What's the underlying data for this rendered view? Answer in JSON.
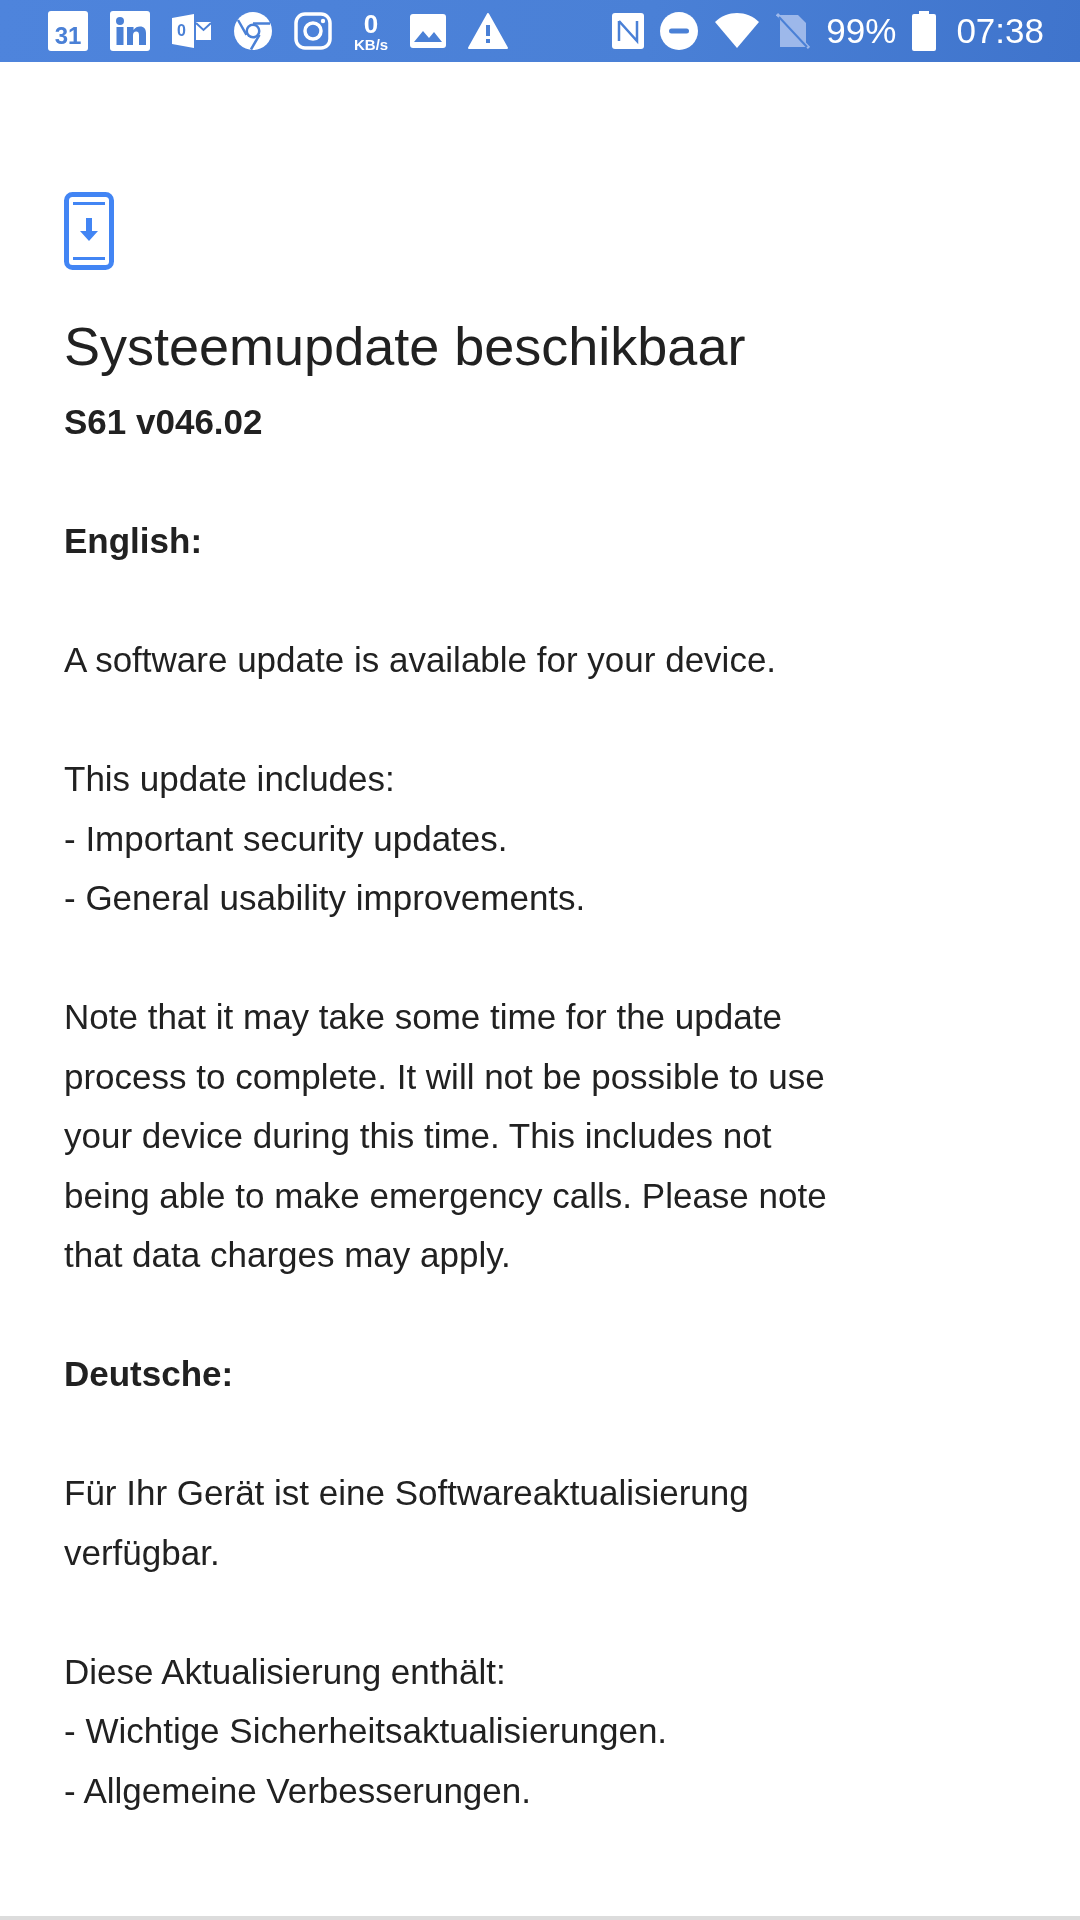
{
  "status_bar": {
    "calendar_date": "31",
    "outlook_badge": "0",
    "net_speed_value": "0",
    "net_speed_unit": "KB/s",
    "battery": "99%",
    "time": "07:38"
  },
  "title": "Systeemupdate beschikbaar",
  "version": "S61 v046.02",
  "sections": [
    {
      "heading": "English:",
      "paragraphs": [
        "A software update is available for your device.",
        "This update includes:\n- Important security updates.\n- General usability improvements.",
        "Note that it may take some time for the update\nprocess to complete. It will not be possible to use\nyour device during this time. This includes not\nbeing able to make emergency calls. Please note\nthat data charges may apply."
      ]
    },
    {
      "heading": "Deutsche:",
      "paragraphs": [
        "Für Ihr Gerät ist eine Softwareaktualisierung\nverfügbar.",
        "Diese Aktualisierung enthält:\n- Wichtige Sicherheitsaktualisierungen.\n- Allgemeine Verbesserungen."
      ]
    }
  ]
}
